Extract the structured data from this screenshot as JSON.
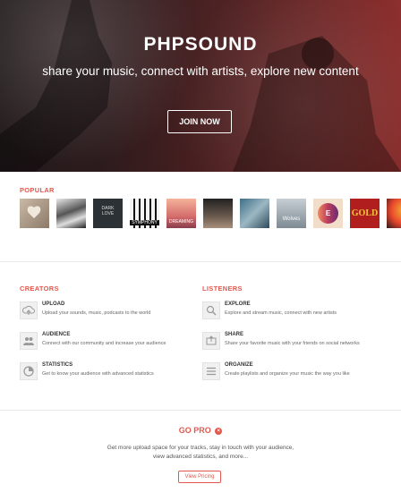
{
  "hero": {
    "title": "PHPSOUND",
    "tagline": "share your music, connect with artists, explore new content",
    "join_label": "JOIN NOW"
  },
  "popular": {
    "label": "POPULAR",
    "covers": [
      {
        "text": ""
      },
      {
        "text": ""
      },
      {
        "text": "DARK\nLOVE"
      },
      {
        "text": "SYMPHONY"
      },
      {
        "text": "DREAMING"
      },
      {
        "text": ""
      },
      {
        "text": ""
      },
      {
        "text": "Wolves"
      },
      {
        "text": "E"
      },
      {
        "text": "GOLD"
      },
      {
        "text": ""
      }
    ]
  },
  "creators": {
    "label": "CREATORS",
    "items": [
      {
        "icon": "upload-icon",
        "name": "UPLOAD",
        "desc": "Upload your sounds, music, podcasts to the world"
      },
      {
        "icon": "audience-icon",
        "name": "AUDIENCE",
        "desc": "Connect with our community and increase your audience"
      },
      {
        "icon": "statistics-icon",
        "name": "STATISTICS",
        "desc": "Get to know your audience with advanced statistics"
      }
    ]
  },
  "listeners": {
    "label": "LISTENERS",
    "items": [
      {
        "icon": "search-icon",
        "name": "EXPLORE",
        "desc": "Explore and stream music, connect with new artists"
      },
      {
        "icon": "share-icon",
        "name": "SHARE",
        "desc": "Share your favorite music with your friends on social networks"
      },
      {
        "icon": "list-icon",
        "name": "ORGANIZE",
        "desc": "Create playlists and organize your music the way you like"
      }
    ]
  },
  "gopro": {
    "label": "GO PRO",
    "desc": "Get more upload space for your tracks, stay in touch with your audience, view advanced statistics, and more...",
    "button": "View Pricing"
  },
  "colors": {
    "accent": "#e2584d"
  }
}
